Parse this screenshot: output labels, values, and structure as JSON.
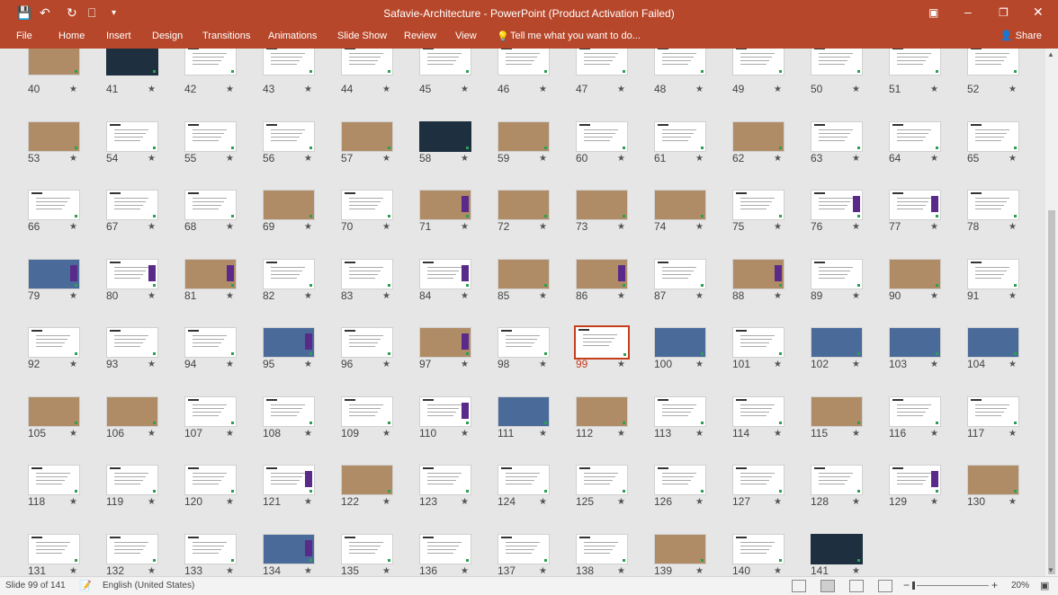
{
  "window": {
    "title": "Safavie-Architecture - PowerPoint (Product Activation Failed)",
    "qa_icons": [
      "save-icon",
      "undo-icon",
      "redo-icon",
      "presenter-icon",
      "customize-icon"
    ],
    "controls": [
      "ribbon-display-icon",
      "minimize-icon",
      "restore-icon",
      "close-icon"
    ]
  },
  "ribbon": {
    "tabs": [
      "File",
      "Home",
      "Insert",
      "Design",
      "Transitions",
      "Animations",
      "Slide Show",
      "Review",
      "View"
    ],
    "tell_me": "Tell me what you want to do...",
    "share": "Share"
  },
  "slides": {
    "numbers": [
      "40",
      "41",
      "42",
      "43",
      "44",
      "45",
      "46",
      "47",
      "48",
      "49",
      "50",
      "51",
      "52",
      "53",
      "54",
      "55",
      "56",
      "57",
      "58",
      "59",
      "60",
      "61",
      "62",
      "63",
      "64",
      "65",
      "66",
      "67",
      "68",
      "69",
      "70",
      "71",
      "72",
      "73",
      "74",
      "75",
      "76",
      "77",
      "78",
      "79",
      "80",
      "81",
      "82",
      "83",
      "84",
      "85",
      "86",
      "87",
      "88",
      "89",
      "90",
      "91",
      "92",
      "93",
      "94",
      "95",
      "96",
      "97",
      "98",
      "99",
      "100",
      "101",
      "102",
      "103",
      "104",
      "105",
      "106",
      "107",
      "108",
      "109",
      "110",
      "111",
      "112",
      "113",
      "114",
      "115",
      "116",
      "117",
      "118",
      "119",
      "120",
      "121",
      "122",
      "123",
      "124",
      "125",
      "126",
      "127",
      "128",
      "129",
      "130",
      "131",
      "132",
      "133",
      "134",
      "135",
      "136",
      "137",
      "138",
      "139",
      "140",
      "141"
    ],
    "selected": "99",
    "star_glyph": "★"
  },
  "status": {
    "slide_info": "Slide 99 of 141",
    "language": "English (United States)",
    "zoom": "20%",
    "zoom_minus": "−",
    "zoom_plus": "+"
  }
}
